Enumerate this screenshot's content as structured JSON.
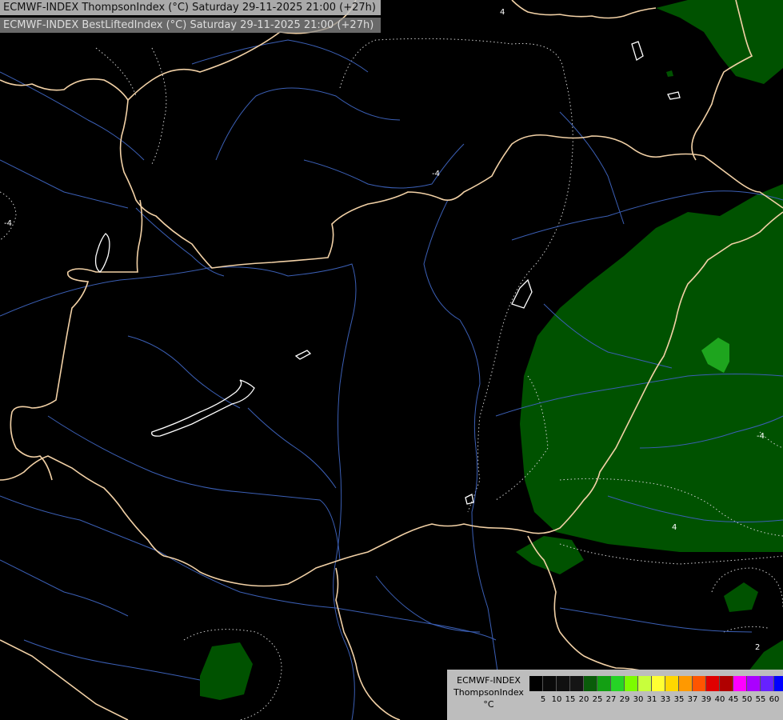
{
  "titles": {
    "line1": "ECMWF-INDEX ThompsonIndex (°C) Saturday 29-11-2025 21:00 (+27h)",
    "line2": "ECMWF-INDEX BestLiftedIndex (°C) Saturday 29-11-2025 21:00 (+27h)"
  },
  "legend": {
    "line1": "ECMWF-INDEX",
    "line2": "ThompsonIndex",
    "line3": "°C",
    "ticks": [
      "5",
      "10",
      "15",
      "20",
      "25",
      "27",
      "29",
      "30",
      "31",
      "33",
      "35",
      "37",
      "39",
      "40",
      "45",
      "50",
      "55",
      "60"
    ],
    "colors": [
      "#000000",
      "#0a0a0a",
      "#101010",
      "#151515",
      "#0a5c0a",
      "#139f13",
      "#26d426",
      "#7cfc00",
      "#c8ff3c",
      "#ffff33",
      "#ffd700",
      "#ff9900",
      "#ff5500",
      "#e00000",
      "#b00000",
      "#ff00ff",
      "#aa00ff",
      "#6622ff",
      "#0000ff"
    ]
  },
  "colors": {
    "border": "#f2d1a6",
    "river": "#3b5fb5",
    "dark_green": "#005200",
    "light_green": "#1ea51e"
  },
  "contour_labels": [
    "-4",
    "4",
    "-4",
    "-4",
    "4",
    "-4",
    "2"
  ]
}
